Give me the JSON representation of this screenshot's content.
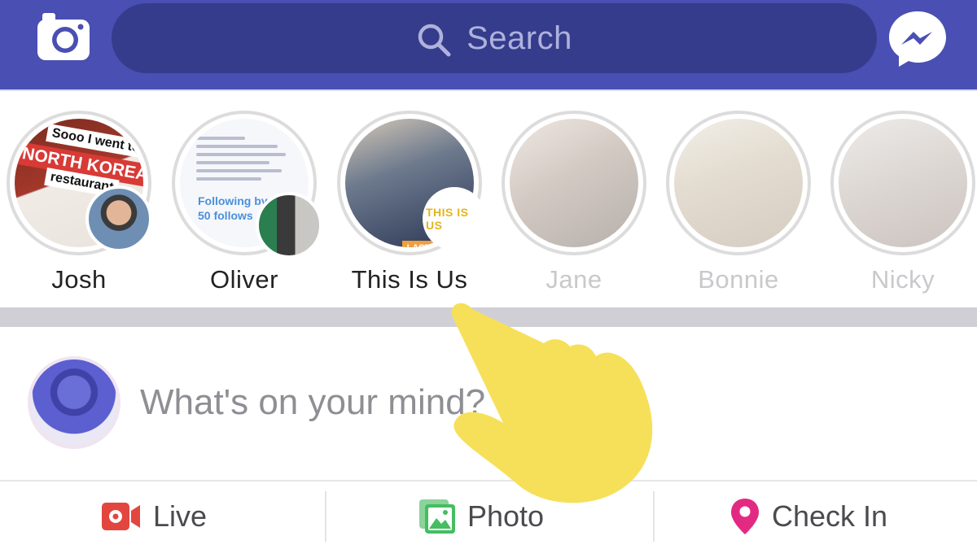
{
  "navbar": {
    "search_placeholder": "Search",
    "camera_icon": "camera-icon",
    "messenger_icon": "messenger-icon",
    "colors": {
      "bar": "#4a4fb3",
      "search": "#363c8c"
    }
  },
  "stories": [
    {
      "name": "Josh",
      "seen": false,
      "headline": [
        "Sooo I went to a",
        "NORTH KOREAN",
        "restaurant"
      ]
    },
    {
      "name": "Oliver",
      "seen": false,
      "overlay_text": [
        "Following by",
        "50 follows"
      ]
    },
    {
      "name": "This Is Us",
      "seen": false,
      "badge": "THIS IS US",
      "tag": "LAST"
    },
    {
      "name": "Jane",
      "seen": true
    },
    {
      "name": "Bonnie",
      "seen": true
    },
    {
      "name": "Nicky",
      "seen": true
    }
  ],
  "composer": {
    "placeholder": "What's on your mind?"
  },
  "actions": {
    "live": "Live",
    "photo": "Photo",
    "check_in": "Check In",
    "colors": {
      "live": "#e2463f",
      "photo": "#45bd62",
      "check_in": "#e32a82"
    }
  }
}
